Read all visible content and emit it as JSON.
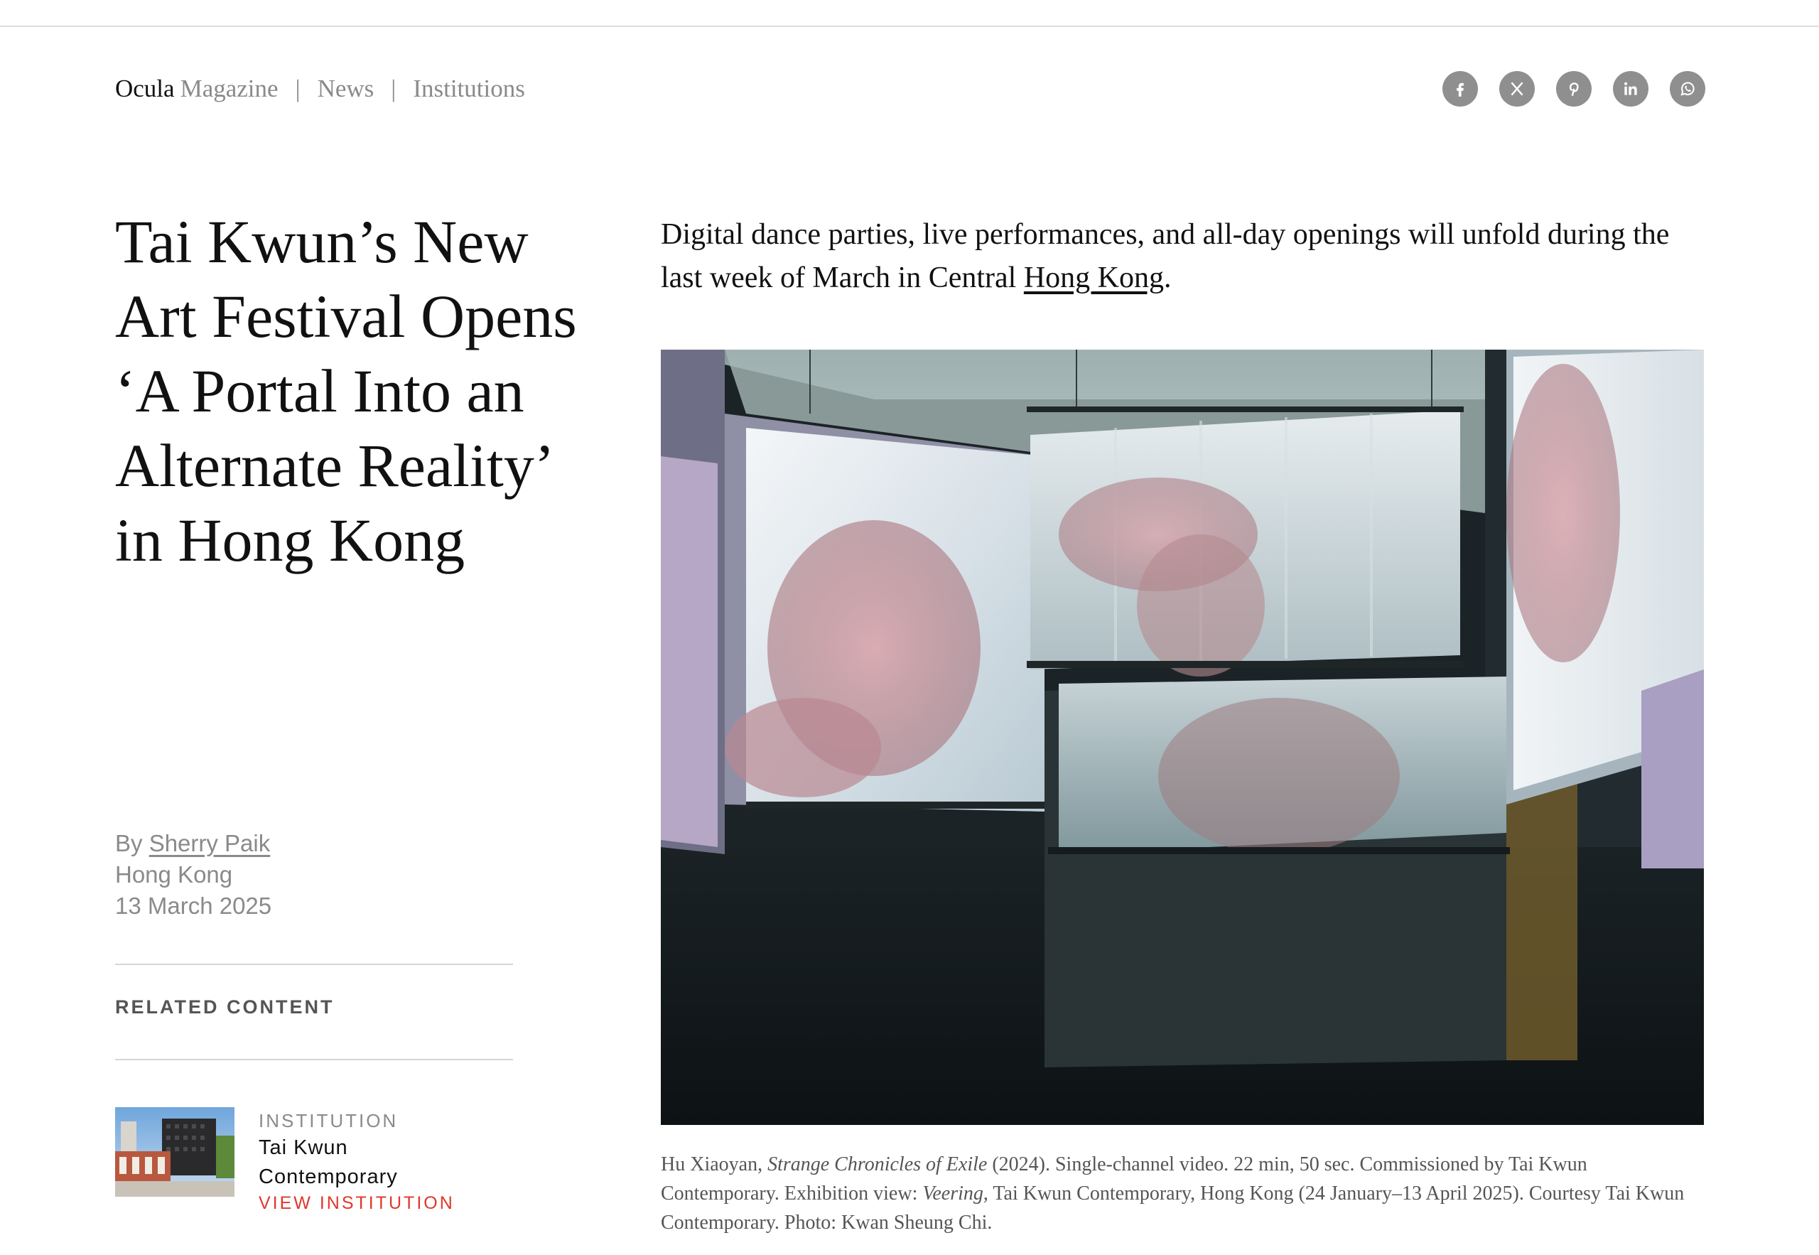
{
  "breadcrumb": {
    "brand": "Ocula",
    "section": "Magazine",
    "separator": "|",
    "items": [
      "News",
      "Institutions"
    ]
  },
  "share": {
    "icons": [
      "facebook-icon",
      "x-icon",
      "pinterest-icon",
      "linkedin-icon",
      "whatsapp-icon"
    ],
    "icon_bg": "#8f8f8f"
  },
  "article": {
    "title": "Tai Kwun’s New Art Festival Opens ‘A Portal Into an Alternate Reality’ in Hong Kong",
    "byline_prefix": "By",
    "author": "Sherry Paik",
    "location": "Hong Kong",
    "date": "13 March 2025",
    "lede_before_link": "Digital dance parties, live performances, and all-day openings will unfold during the last week of March in Central ",
    "lede_link": "Hong Kong",
    "lede_after_link": "."
  },
  "related": {
    "label": "RELATED CONTENT",
    "type": "INSTITUTION",
    "name_line1": "Tai Kwun",
    "name_line2": "Contemporary",
    "link": "VIEW INSTITUTION",
    "link_color": "#e0372c"
  },
  "caption": {
    "artist": "Hu Xiaoyan, ",
    "work_title": "Strange Chronicles of Exile",
    "part1": " (2024). Single-channel video. 22 min, 50 sec. Commissioned by Tai Kwun Contemporary. Exhibition view: ",
    "exhibition": "Veering",
    "part2": ", Tai Kwun Contemporary, Hong Kong (24 January–13 April 2025). Courtesy Tai Kwun Contemporary. Photo: Kwan Sheung Chi."
  }
}
